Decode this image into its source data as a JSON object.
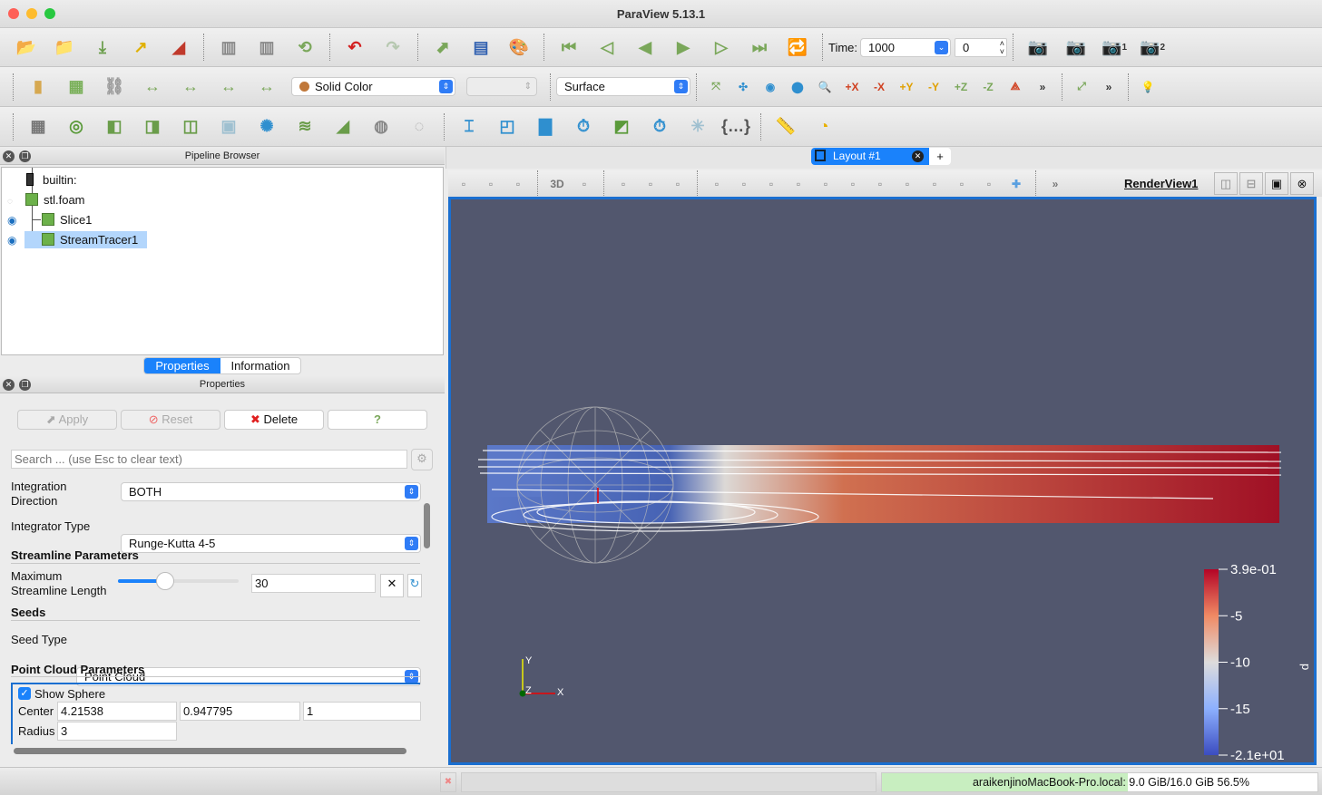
{
  "window": {
    "title": "ParaView 5.13.1"
  },
  "toolbar1": {
    "icons": [
      {
        "name": "open-file-icon",
        "glyph": "📂",
        "color": "#e8c24a"
      },
      {
        "name": "load-state-icon",
        "glyph": "📁",
        "color": "#e8c24a"
      },
      {
        "name": "save-data-icon",
        "glyph": "⤓",
        "color": "#6a9d4a"
      },
      {
        "name": "connect-icon",
        "glyph": "↗",
        "color": "#e0b000"
      },
      {
        "name": "paraview-logo-icon",
        "glyph": "◢",
        "color": "#c0392b"
      },
      {
        "name": "sep"
      },
      {
        "name": "server-connect-icon",
        "glyph": "▥",
        "color": "#888"
      },
      {
        "name": "server-disconnect-icon",
        "glyph": "▥",
        "color": "#888"
      },
      {
        "name": "auto-apply-icon",
        "glyph": "⟲",
        "color": "#7aa75a"
      },
      {
        "name": "sep"
      },
      {
        "name": "undo-icon",
        "glyph": "↶",
        "color": "#d32020"
      },
      {
        "name": "redo-icon",
        "glyph": "↷",
        "color": "#b6c8b0"
      },
      {
        "name": "sep"
      },
      {
        "name": "interact-mode-icon",
        "glyph": "⬈",
        "color": "#7aa75a"
      },
      {
        "name": "color-map-editor-icon",
        "glyph": "▤",
        "color": "#3060b0"
      },
      {
        "name": "palette-icon",
        "glyph": "🎨",
        "color": "#c58a40"
      },
      {
        "name": "sep"
      },
      {
        "name": "first-frame-icon",
        "glyph": "⏮",
        "color": "#7aa75a"
      },
      {
        "name": "previous-frame-icon",
        "glyph": "◁",
        "color": "#7aa75a"
      },
      {
        "name": "reverse-play-icon",
        "glyph": "◀",
        "color": "#7aa75a"
      },
      {
        "name": "play-icon",
        "glyph": "▶",
        "color": "#7aa75a"
      },
      {
        "name": "next-frame-icon",
        "glyph": "▷",
        "color": "#7aa75a"
      },
      {
        "name": "last-frame-icon",
        "glyph": "⏭",
        "color": "#7aa75a"
      },
      {
        "name": "loop-icon",
        "glyph": "🔁",
        "color": "#7aa75a"
      }
    ],
    "time_label": "Time:",
    "time_value": "1000",
    "timestep_value": "0",
    "camera_icons": [
      {
        "name": "camera-adjust-icon",
        "glyph": "📷",
        "color": "#888"
      },
      {
        "name": "camera-add-icon",
        "glyph": "📷",
        "color": "#888"
      },
      {
        "name": "camera-1-icon",
        "glyph": "📷",
        "color": "#888"
      },
      {
        "name": "camera-2-icon",
        "glyph": "📷",
        "color": "#888"
      }
    ],
    "camera_sub": [
      "",
      "",
      "1",
      "2"
    ]
  },
  "toolbar2": {
    "icons_left": [
      {
        "name": "toggle-color-legend-icon",
        "glyph": "▮",
        "color": "#d6a850"
      },
      {
        "name": "edit-color-map-icon",
        "glyph": "▦",
        "color": "#7ab05a"
      },
      {
        "name": "reset-range-icon",
        "glyph": "⛓",
        "color": "#999"
      },
      {
        "name": "rescale-range-icon",
        "glyph": "↔",
        "color": "#7aa75a"
      },
      {
        "name": "rescale-custom-range-icon",
        "glyph": "↔",
        "color": "#7aa75a"
      },
      {
        "name": "rescale-temporal-range-icon",
        "glyph": "↔",
        "color": "#7aa75a"
      },
      {
        "name": "rescale-visible-range-icon",
        "glyph": "↔",
        "color": "#7aa75a"
      }
    ],
    "coloring": "Solid Color",
    "coloring_swatch": "#c0783a",
    "component": "",
    "representation": "Surface",
    "icons_right": [
      {
        "name": "reset-camera-icon",
        "glyph": "⤧",
        "color": "#7aa75a"
      },
      {
        "name": "reset-camera-closest-icon",
        "glyph": "✣",
        "color": "#2f8fcf"
      },
      {
        "name": "zoom-to-data-icon",
        "glyph": "◉",
        "color": "#2f8fcf"
      },
      {
        "name": "zoom-closest-icon",
        "glyph": "⬤",
        "color": "#2f8fcf"
      },
      {
        "name": "zoom-to-box-icon",
        "glyph": "🔍",
        "color": "#888"
      },
      {
        "name": "view-plus-x-icon",
        "glyph": "+X",
        "color": "#d04020"
      },
      {
        "name": "view-minus-x-icon",
        "glyph": "-X",
        "color": "#d04020"
      },
      {
        "name": "view-plus-y-icon",
        "glyph": "+Y",
        "color": "#e0a000"
      },
      {
        "name": "view-minus-y-icon",
        "glyph": "-Y",
        "color": "#e0a000"
      },
      {
        "name": "view-plus-z-icon",
        "glyph": "+Z",
        "color": "#7aa75a"
      },
      {
        "name": "view-minus-z-icon",
        "glyph": "-Z",
        "color": "#7aa75a"
      },
      {
        "name": "isometric-view-icon",
        "glyph": "⟁",
        "color": "#d04020"
      },
      {
        "name": "more-icon",
        "glyph": "»",
        "color": "#333"
      },
      {
        "name": "sep"
      },
      {
        "name": "orientation-axes-icon",
        "glyph": "⤢",
        "color": "#7aa75a"
      },
      {
        "name": "more-icon",
        "glyph": "»",
        "color": "#333"
      },
      {
        "name": "sep"
      },
      {
        "name": "light-kit-icon",
        "glyph": "💡",
        "color": "#e8b000"
      }
    ]
  },
  "toolbar3": {
    "icons": [
      {
        "name": "calculator-icon",
        "glyph": "▦",
        "color": "#777"
      },
      {
        "name": "contour-icon",
        "glyph": "◎",
        "color": "#5a9a3a"
      },
      {
        "name": "clip-icon",
        "glyph": "◧",
        "color": "#6a9d4a"
      },
      {
        "name": "slice-icon",
        "glyph": "◨",
        "color": "#6a9d4a"
      },
      {
        "name": "threshold-icon",
        "glyph": "◫",
        "color": "#6a9d4a"
      },
      {
        "name": "extract-subset-icon",
        "glyph": "▣",
        "color": "#9fc0d0"
      },
      {
        "name": "glyph-icon",
        "glyph": "✺",
        "color": "#2f8fcf"
      },
      {
        "name": "stream-tracer-icon",
        "glyph": "≋",
        "color": "#6a9d4a"
      },
      {
        "name": "warp-by-vector-icon",
        "glyph": "◢",
        "color": "#6a9d4a"
      },
      {
        "name": "group-datasets-icon",
        "glyph": "◍",
        "color": "#888"
      },
      {
        "name": "extract-level-icon",
        "glyph": "◌",
        "color": "#aaa"
      },
      {
        "name": "sep"
      },
      {
        "name": "plot-over-line-icon",
        "glyph": "⌶",
        "color": "#2f8fcf"
      },
      {
        "name": "plot-selection-icon",
        "glyph": "◰",
        "color": "#2f8fcf"
      },
      {
        "name": "histogram-icon",
        "glyph": "▇",
        "color": "#2f8fcf"
      },
      {
        "name": "plot-data-over-time-icon",
        "glyph": "⏱",
        "color": "#2f8fcf"
      },
      {
        "name": "probe-icon",
        "glyph": "◩",
        "color": "#5a9a3a"
      },
      {
        "name": "plot-global-variables-icon",
        "glyph": "⏱",
        "color": "#2f8fcf"
      },
      {
        "name": "cell-centers-icon",
        "glyph": "✳",
        "color": "#9fc0d0"
      },
      {
        "name": "python-calculator-icon",
        "glyph": "{…}",
        "color": "#555"
      },
      {
        "name": "sep"
      },
      {
        "name": "ruler-icon",
        "glyph": "📏",
        "color": "#e8b000"
      },
      {
        "name": "protractor-icon",
        "glyph": "◔",
        "color": "#e8b000"
      }
    ]
  },
  "pipeline": {
    "title": "Pipeline Browser",
    "items": [
      {
        "label": "builtin:"
      },
      {
        "label": "stl.foam"
      },
      {
        "label": "Slice1"
      },
      {
        "label": "StreamTracer1"
      }
    ]
  },
  "tabs": {
    "properties": "Properties",
    "information": "Information"
  },
  "properties": {
    "title": "Properties",
    "apply": "Apply",
    "reset": "Reset",
    "delete": "Delete",
    "help": "?",
    "search_placeholder": "Search ... (use Esc to clear text)",
    "integration_direction_label": "Integration\nDirection",
    "integration_direction": "BOTH",
    "integrator_type_label": "Integrator Type",
    "integrator_type": "Runge-Kutta 4-5",
    "streamline_section": "Streamline Parameters",
    "max_length_label": "Maximum\nStreamline Length",
    "max_length": "30",
    "max_length_slider": 0.3,
    "seeds_section": "Seeds",
    "seed_type_label": "Seed Type",
    "seed_type": "Point Cloud",
    "point_cloud_section": "Point Cloud Parameters",
    "show_sphere_label": "Show Sphere",
    "show_sphere": true,
    "center_label": "Center",
    "center": [
      "4.21538",
      "0.947795",
      "1"
    ],
    "radius_label": "Radius",
    "radius": "3"
  },
  "layout": {
    "tab": "Layout #1",
    "add": "+",
    "view_name": "RenderView1",
    "view_3d": "3D"
  },
  "render": {
    "background": "#52576e",
    "colorbar": {
      "title": "p",
      "ticks": [
        "3.9e-01",
        "-5",
        "-10",
        "-15",
        "-2.1e+01"
      ],
      "colors": [
        "#b40426",
        "#f08a64",
        "#dddcdc",
        "#8db0fe",
        "#3b4cc0"
      ]
    },
    "axes": {
      "x": "X",
      "y": "Y",
      "z": "Z"
    }
  },
  "status": {
    "memory": "araikenjinoMacBook-Pro.local: 9.0 GiB/16.0 GiB 56.5%",
    "memory_fraction": 0.565
  }
}
